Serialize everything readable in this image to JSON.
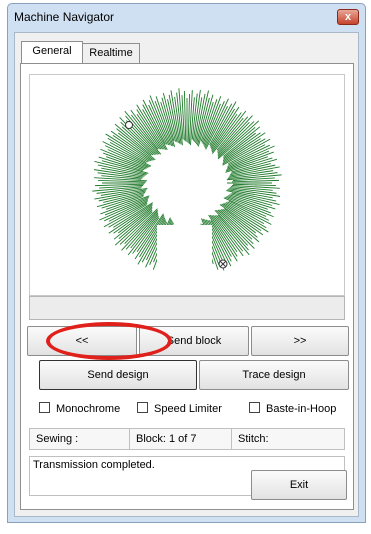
{
  "window": {
    "title": "Machine Navigator",
    "close_label": "x"
  },
  "tabs": [
    {
      "label": "General"
    },
    {
      "label": "Realtime"
    }
  ],
  "preview": {
    "design_color": "#1f7a2a"
  },
  "buttons": {
    "prev": "<<",
    "send_block": "Send block",
    "next": ">>",
    "send_design": "Send design",
    "trace_design": "Trace design",
    "exit": "Exit"
  },
  "options": {
    "monochrome": {
      "label": "Monochrome",
      "checked": false
    },
    "speed_limiter": {
      "label": "Speed Limiter",
      "checked": false
    },
    "baste_in_hoop": {
      "label": "Baste-in-Hoop",
      "checked": false
    }
  },
  "status_fields": {
    "sewing": "Sewing :",
    "block": "Block: 1 of 7",
    "stitch": "Stitch:"
  },
  "message": "Transmission completed.",
  "annotation": {
    "color": "#e0201a"
  }
}
